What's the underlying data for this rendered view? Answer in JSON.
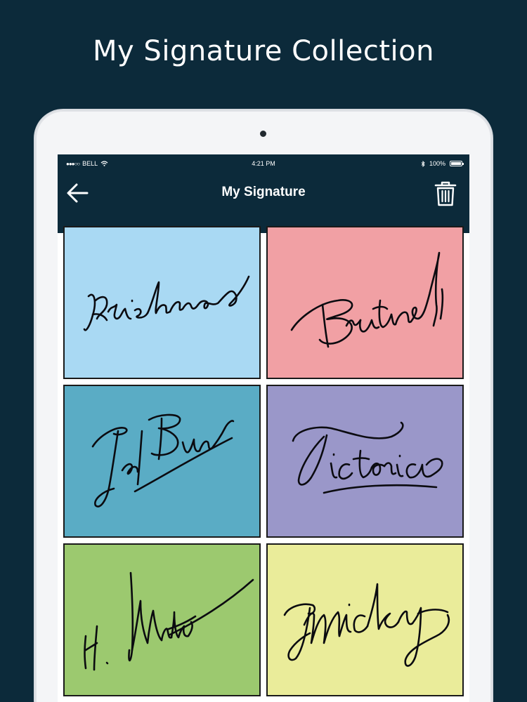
{
  "promo": {
    "headline": "My Signature Collection"
  },
  "status_bar": {
    "carrier": "BELL",
    "time": "4:21 PM",
    "battery": "100%"
  },
  "nav": {
    "title": "My Signature",
    "back_icon": "arrow-left-icon",
    "delete_icon": "trash-icon"
  },
  "signatures": [
    {
      "name": "Krishna",
      "bg": "#a9d9f3"
    },
    {
      "name": "Britney",
      "bg": "#f1a0a4"
    },
    {
      "name": "Jel Bun",
      "bg": "#5aacc5"
    },
    {
      "name": "Victoria",
      "bg": "#9a97c9"
    },
    {
      "name": "H. Mike",
      "bg": "#9cc96f"
    },
    {
      "name": "Micky",
      "bg": "#eaec9a"
    }
  ],
  "colors": {
    "background": "#0c2a3a",
    "tablet": "#f4f5f7",
    "nav_bar": "#0c2a3a"
  }
}
